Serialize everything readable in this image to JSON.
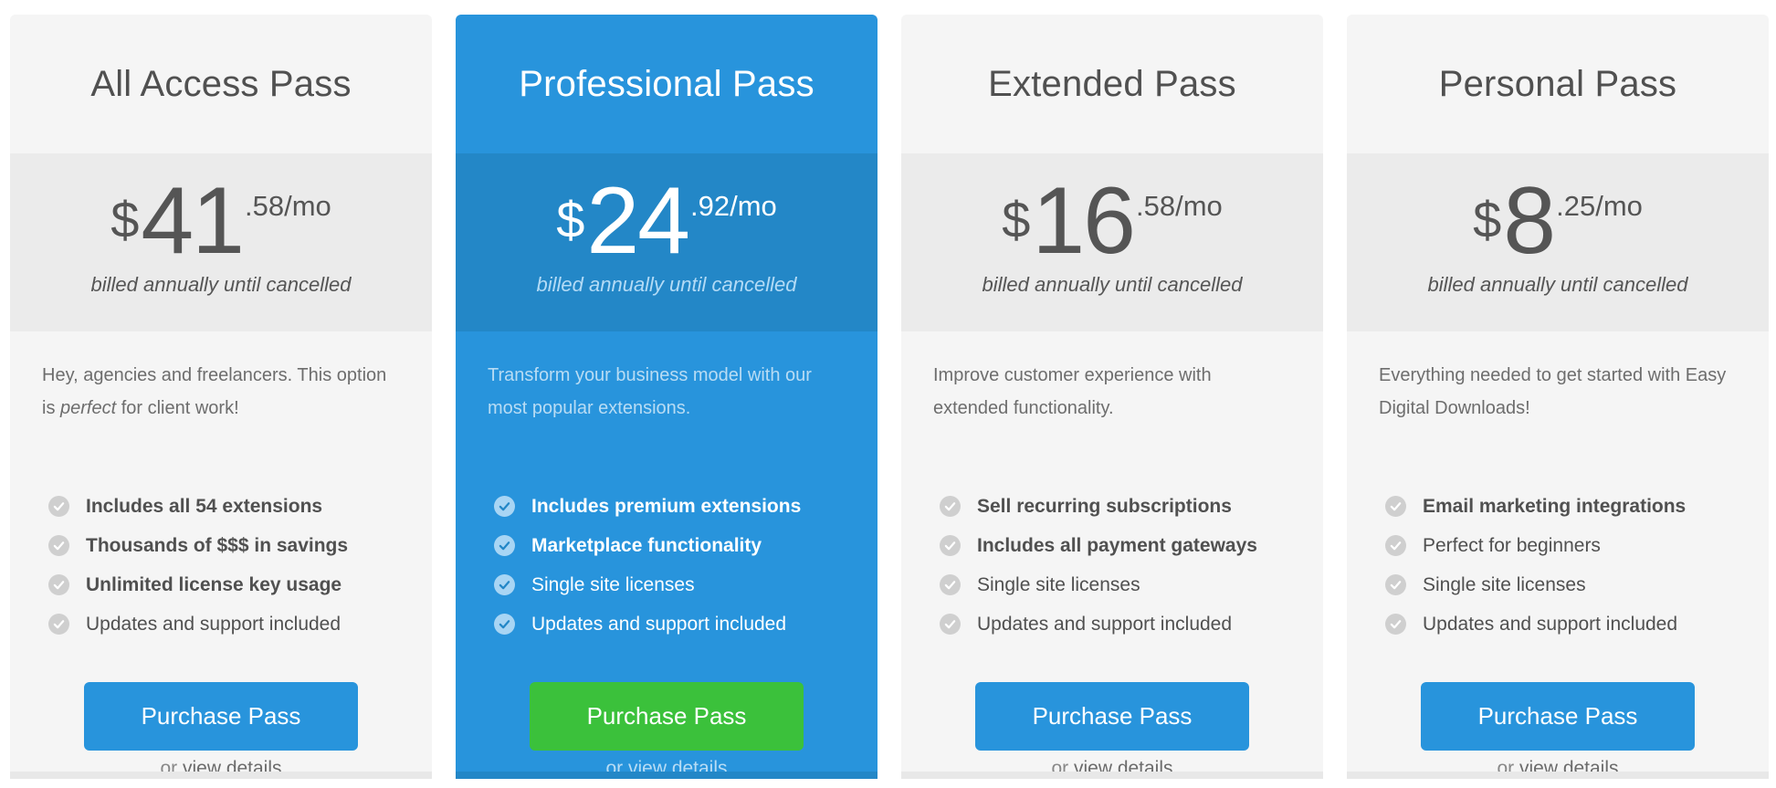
{
  "colors": {
    "primary_blue": "#2894dc",
    "featured_price_bg": "#2387c7",
    "featured_button": "#3bc13b",
    "card_bg": "#f5f5f5",
    "price_bg": "#ebebeb"
  },
  "plans": [
    {
      "title": "All Access Pass",
      "currency": "$",
      "dollars": "41",
      "cents": ".58/mo",
      "billing": "billed annually until cancelled",
      "desc_before": "Hey, agencies and freelancers. This option is ",
      "desc_em": "perfect",
      "desc_after": " for client work!",
      "features": [
        {
          "text": "Includes all 54 extensions",
          "bold": true,
          "icon": "check-circle-icon"
        },
        {
          "text": "Thousands of $$$ in savings",
          "bold": true,
          "icon": "check-circle-icon"
        },
        {
          "text": "Unlimited license key usage",
          "bold": true,
          "icon": "check-circle-icon"
        },
        {
          "text": "Updates and support included",
          "bold": false,
          "icon": "check-circle-icon"
        }
      ],
      "button": "Purchase Pass",
      "or": "or ",
      "link": "view details"
    },
    {
      "title": "Professional Pass",
      "featured": true,
      "currency": "$",
      "dollars": "24",
      "cents": ".92/mo",
      "billing": "billed annually until cancelled",
      "desc_before": "Transform your business model with our most popular extensions.",
      "desc_em": "",
      "desc_after": "",
      "features": [
        {
          "text": "Includes premium extensions",
          "bold": true,
          "icon": "check-circle-icon"
        },
        {
          "text": "Marketplace functionality",
          "bold": true,
          "icon": "check-circle-icon"
        },
        {
          "text": "Single site licenses",
          "bold": false,
          "icon": "check-circle-icon"
        },
        {
          "text": "Updates and support included",
          "bold": false,
          "icon": "check-circle-icon"
        }
      ],
      "button": "Purchase Pass",
      "or": "or ",
      "link": "view details"
    },
    {
      "title": "Extended Pass",
      "currency": "$",
      "dollars": "16",
      "cents": ".58/mo",
      "billing": "billed annually until cancelled",
      "desc_before": "Improve customer experience with extended functionality.",
      "desc_em": "",
      "desc_after": "",
      "features": [
        {
          "text": "Sell recurring subscriptions",
          "bold": true,
          "icon": "check-circle-icon"
        },
        {
          "text": "Includes all payment gateways",
          "bold": true,
          "icon": "check-circle-icon"
        },
        {
          "text": "Single site licenses",
          "bold": false,
          "icon": "check-circle-icon"
        },
        {
          "text": "Updates and support included",
          "bold": false,
          "icon": "check-circle-icon"
        }
      ],
      "button": "Purchase Pass",
      "or": "or ",
      "link": "view details"
    },
    {
      "title": "Personal Pass",
      "currency": "$",
      "dollars": "8",
      "cents": ".25/mo",
      "billing": "billed annually until cancelled",
      "desc_before": "Everything needed to get started with Easy Digital Downloads!",
      "desc_em": "",
      "desc_after": "",
      "features": [
        {
          "text": "Email marketing integrations",
          "bold": true,
          "icon": "check-circle-icon"
        },
        {
          "text": "Perfect for beginners",
          "bold": false,
          "icon": "check-circle-icon"
        },
        {
          "text": "Single site licenses",
          "bold": false,
          "icon": "check-circle-icon"
        },
        {
          "text": "Updates and support included",
          "bold": false,
          "icon": "check-circle-icon"
        }
      ],
      "button": "Purchase Pass",
      "or": "or ",
      "link": "view details"
    }
  ]
}
